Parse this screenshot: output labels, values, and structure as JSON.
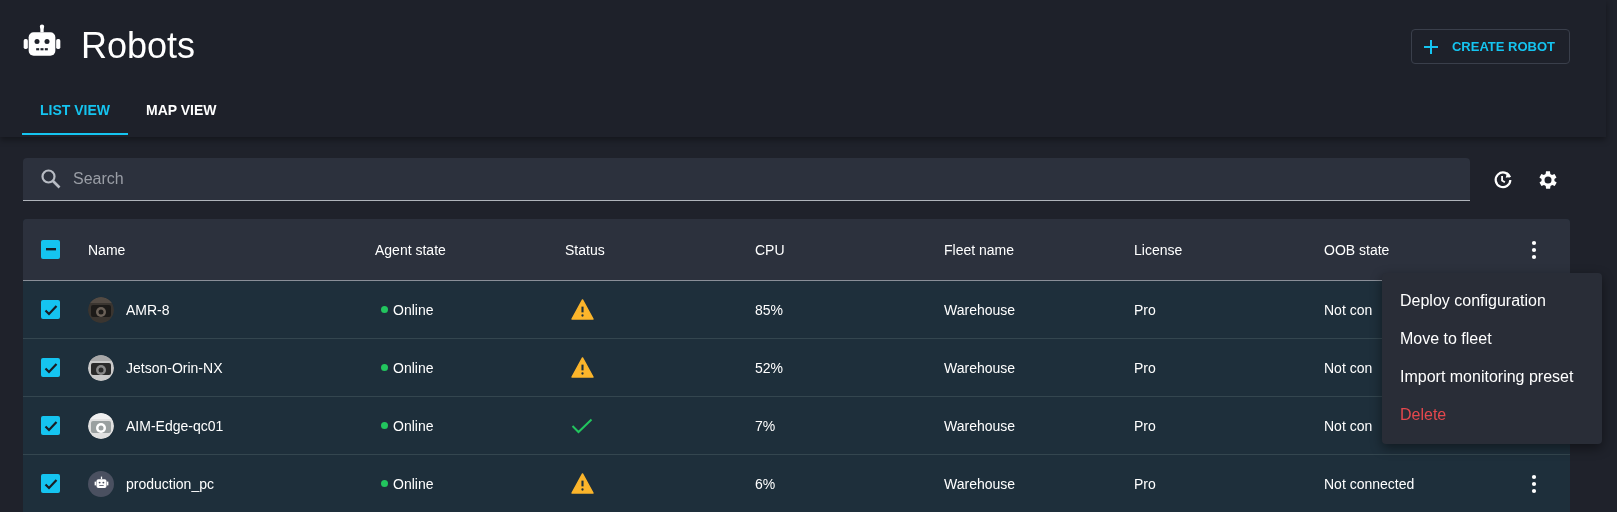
{
  "page": {
    "title": "Robots"
  },
  "create_button": {
    "label": "CREATE ROBOT"
  },
  "tabs": [
    {
      "label": "LIST VIEW",
      "selected": true
    },
    {
      "label": "MAP VIEW",
      "selected": false
    }
  ],
  "search": {
    "placeholder": "Search"
  },
  "table": {
    "header_checkbox": {
      "indeterminate": true
    },
    "columns": [
      "Name",
      "Agent state",
      "Status",
      "CPU",
      "Fleet name",
      "License",
      "OOB state"
    ],
    "rows": [
      {
        "selected": true,
        "name": "AMR-8",
        "agent_state": "Online",
        "online": true,
        "status": {
          "kind": "warning"
        },
        "cpu": "85%",
        "fleet": "Warehouse",
        "license": "Pro",
        "oob_state": "Not con"
      },
      {
        "selected": true,
        "name": "Jetson-Orin-NX",
        "agent_state": "Online",
        "online": true,
        "status": {
          "kind": "warning"
        },
        "cpu": "52%",
        "fleet": "Warehouse",
        "license": "Pro",
        "oob_state": "Not con"
      },
      {
        "selected": true,
        "name": "AIM-Edge-qc01",
        "agent_state": "Online",
        "online": true,
        "status": {
          "kind": "ok"
        },
        "cpu": "7%",
        "fleet": "Warehouse",
        "license": "Pro",
        "oob_state": "Not con"
      },
      {
        "selected": true,
        "avatar": {
          "kind": "robot"
        },
        "name": "production_pc",
        "agent_state": "Online",
        "online": true,
        "status": {
          "kind": "warning"
        },
        "cpu": "6%",
        "fleet": "Warehouse",
        "license": "Pro",
        "oob_state": "Not connected"
      }
    ]
  },
  "menu": {
    "items": [
      {
        "label": "Deploy configuration",
        "kind": "normal"
      },
      {
        "label": "Move to fleet",
        "kind": "normal"
      },
      {
        "label": "Import monitoring preset",
        "kind": "normal"
      },
      {
        "label": "Delete",
        "kind": "danger"
      }
    ]
  }
}
